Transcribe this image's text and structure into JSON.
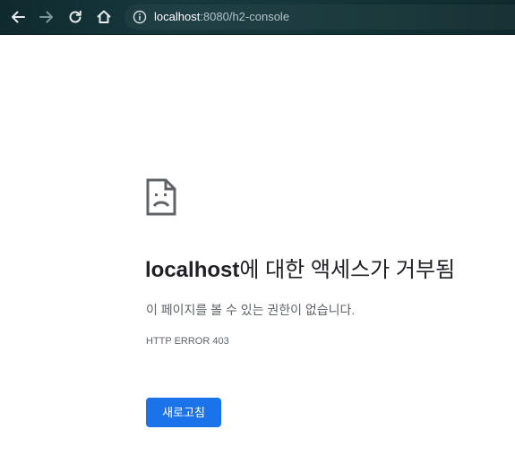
{
  "browser": {
    "nav": {
      "back_icon": "arrow-left-icon",
      "forward_icon": "arrow-right-icon",
      "reload_icon": "reload-icon",
      "home_icon": "home-icon"
    },
    "address": {
      "icon": "info-icon",
      "host": "localhost",
      "rest": ":8080/h2-console"
    },
    "colors": {
      "toolbar": "#143438",
      "url_host": "#ffffff",
      "url_rest": "#b3c4c6"
    }
  },
  "error_page": {
    "icon": "sad-page-icon",
    "title_host": "localhost",
    "title_rest": "에 대한 액세스가 거부됨",
    "description": "이 페이지를 볼 수 있는 권한이 없습니다.",
    "error_code": "HTTP ERROR 403",
    "reload_label": "새로고침",
    "colors": {
      "title": "#202124",
      "body_text": "#5f6368",
      "button": "#1a73e8",
      "button_text": "#ffffff"
    }
  }
}
